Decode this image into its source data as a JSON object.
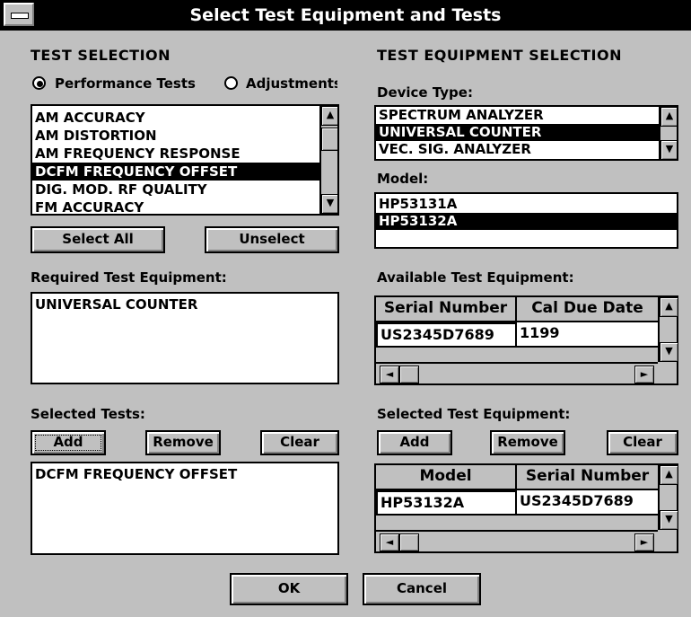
{
  "window": {
    "title": "Select Test Equipment and Tests"
  },
  "test_selection": {
    "header": "TEST SELECTION",
    "radio_performance": "Performance Tests",
    "radio_adjustments": "Adjustments",
    "selected_mode": "Performance Tests",
    "tests": [
      "AM ACCURACY",
      "AM DISTORTION",
      "AM FREQUENCY RESPONSE",
      "DCFM FREQUENCY OFFSET",
      "DIG. MOD. RF QUALITY",
      "FM ACCURACY"
    ],
    "selected_test": "DCFM FREQUENCY OFFSET",
    "select_all": "Select All",
    "unselect": "Unselect",
    "required_label": "Required Test Equipment:",
    "required_items": [
      "UNIVERSAL COUNTER"
    ],
    "selected_tests_label": "Selected Tests:",
    "add": "Add",
    "remove": "Remove",
    "clear": "Clear",
    "selected_tests": [
      "DCFM FREQUENCY OFFSET"
    ]
  },
  "equipment_selection": {
    "header": "TEST EQUIPMENT SELECTION",
    "device_type_label": "Device Type:",
    "device_types": [
      "SPECTRUM ANALYZER",
      "UNIVERSAL COUNTER",
      "VEC. SIG. ANALYZER"
    ],
    "selected_device_type": "UNIVERSAL COUNTER",
    "model_label": "Model:",
    "models": [
      "HP53131A",
      "HP53132A"
    ],
    "selected_model": "HP53132A",
    "available_label": "Available Test Equipment:",
    "available_columns": [
      "Serial Number",
      "Cal Due Date"
    ],
    "available_rows": [
      [
        "US2345D7689",
        "1199"
      ]
    ],
    "selected_label": "Selected Test Equipment:",
    "add": "Add",
    "remove": "Remove",
    "clear": "Clear",
    "selected_columns": [
      "Model",
      "Serial Number"
    ],
    "selected_rows": [
      [
        "HP53132A",
        "US2345D7689"
      ]
    ]
  },
  "footer": {
    "ok": "OK",
    "cancel": "Cancel"
  }
}
